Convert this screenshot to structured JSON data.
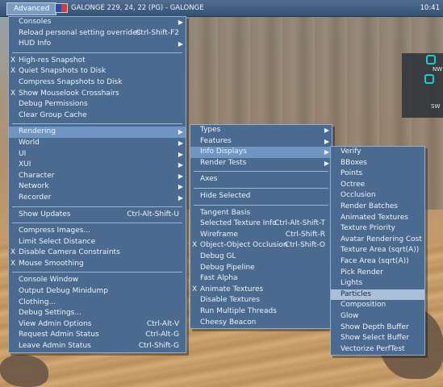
{
  "menubar": {
    "advanced_label": "Advanced",
    "location": "GALONGE 229, 24, 22 (PG) - GALONGE",
    "clock": "10:41"
  },
  "minimap": {
    "nw": "NW",
    "sw": "SW"
  },
  "advanced_menu": [
    {
      "label": "Consoles",
      "arrow": true
    },
    {
      "label": "Reload personal setting overrides",
      "shortcut": "Ctrl-Shift-F2"
    },
    {
      "label": "HUD Info",
      "arrow": true
    },
    {
      "sep": true
    },
    {
      "label": "High-res Snapshot",
      "check": "X"
    },
    {
      "label": "Quiet Snapshots to Disk",
      "check": "X"
    },
    {
      "label": "Compress Snapshots to Disk"
    },
    {
      "label": "Show Mouselook Crosshairs",
      "check": "X"
    },
    {
      "label": "Debug Permissions"
    },
    {
      "label": "Clear Group Cache"
    },
    {
      "sep": true
    },
    {
      "label": "Rendering",
      "arrow": true,
      "highlight": true
    },
    {
      "label": "World",
      "arrow": true
    },
    {
      "label": "UI",
      "arrow": true
    },
    {
      "label": "XUI",
      "arrow": true
    },
    {
      "label": "Character",
      "arrow": true
    },
    {
      "label": "Network",
      "arrow": true
    },
    {
      "label": "Recorder",
      "arrow": true
    },
    {
      "sep": true
    },
    {
      "label": "Show Updates",
      "shortcut": "Ctrl-Alt-Shift-U"
    },
    {
      "sep": true
    },
    {
      "label": "Compress Images..."
    },
    {
      "label": "Limit Select Distance"
    },
    {
      "label": "Disable Camera Constraints",
      "check": "X"
    },
    {
      "label": "Mouse Smoothing",
      "check": "X"
    },
    {
      "sep": true
    },
    {
      "label": "Console Window"
    },
    {
      "label": "Output Debug Minidump"
    },
    {
      "label": "Clothing..."
    },
    {
      "label": "Debug Settings..."
    },
    {
      "label": "View Admin Options",
      "shortcut": "Ctrl-Alt-V"
    },
    {
      "label": "Request Admin Status",
      "shortcut": "Ctrl-Alt-G"
    },
    {
      "label": "Leave Admin Status",
      "shortcut": "Ctrl-Shift-G"
    }
  ],
  "rendering_menu": [
    {
      "label": "Types",
      "arrow": true
    },
    {
      "label": "Features",
      "arrow": true
    },
    {
      "label": "Info Displays",
      "arrow": true,
      "highlight": true
    },
    {
      "label": "Render Tests",
      "arrow": true
    },
    {
      "sep": true
    },
    {
      "label": "Axes"
    },
    {
      "sep": true
    },
    {
      "label": "Hide Selected"
    },
    {
      "sep": true
    },
    {
      "label": "Tangent Basis"
    },
    {
      "label": "Selected Texture Info",
      "shortcut": "Ctrl-Alt-Shift-T"
    },
    {
      "label": "Wireframe",
      "shortcut": "Ctrl-Shift-R"
    },
    {
      "label": "Object-Object Occlusion",
      "check": "X",
      "shortcut": "Ctrl-Shift-O"
    },
    {
      "label": "Debug GL"
    },
    {
      "label": "Debug Pipeline"
    },
    {
      "label": "Fast Alpha"
    },
    {
      "label": "Animate Textures",
      "check": "X"
    },
    {
      "label": "Disable Textures"
    },
    {
      "label": "Run Multiple Threads"
    },
    {
      "label": "Cheesy Beacon"
    }
  ],
  "info_menu": [
    {
      "label": "Verify"
    },
    {
      "label": "BBoxes"
    },
    {
      "label": "Points"
    },
    {
      "label": "Octree"
    },
    {
      "label": "Occlusion"
    },
    {
      "label": "Render Batches"
    },
    {
      "label": "Animated Textures"
    },
    {
      "label": "Texture Priority"
    },
    {
      "label": "Avatar Rendering Cost"
    },
    {
      "label": "Texture Area (sqrt(A))"
    },
    {
      "label": "Face Area (sqrt(A))"
    },
    {
      "label": "Pick Render"
    },
    {
      "label": "Lights"
    },
    {
      "label": "Particles",
      "highlight": true
    },
    {
      "label": "Composition"
    },
    {
      "label": "Glow"
    },
    {
      "label": "Show Depth Buffer"
    },
    {
      "label": "Show Select Buffer"
    },
    {
      "label": "Vectorize PerfTest"
    }
  ]
}
